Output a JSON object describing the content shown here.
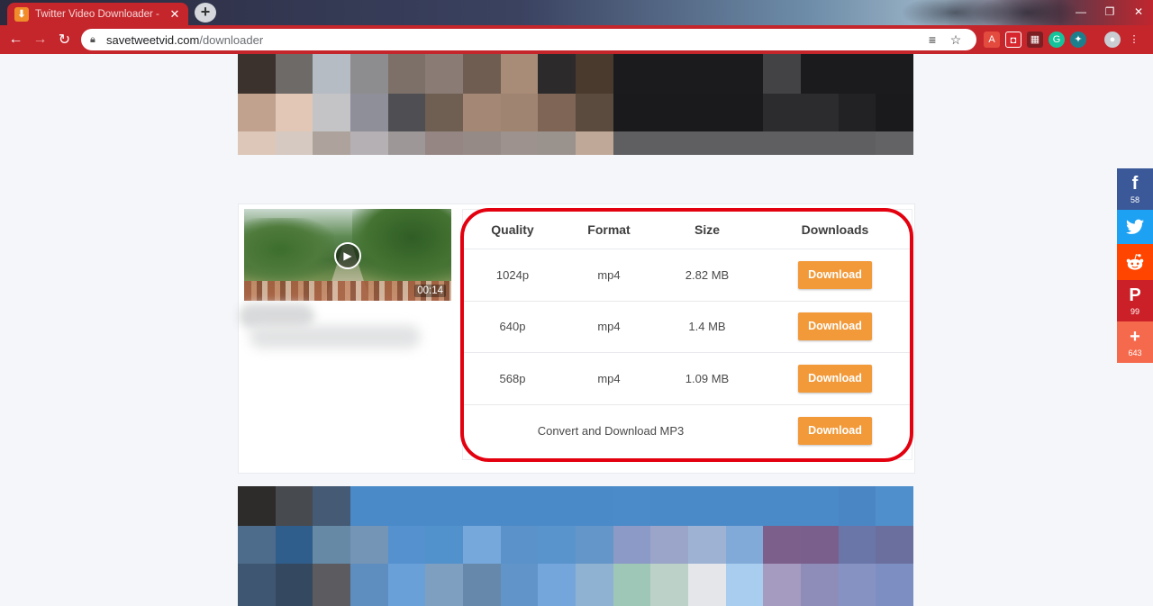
{
  "browser": {
    "tab_title": "Twitter Video Downloader - Dow",
    "url_host": "savetweetvid.com",
    "url_path": "/downloader"
  },
  "video": {
    "duration": "00:14"
  },
  "table": {
    "headers": [
      "Quality",
      "Format",
      "Size",
      "Downloads"
    ],
    "rows": [
      {
        "quality": "1024p",
        "format": "mp4",
        "size": "2.82 MB",
        "button": "Download"
      },
      {
        "quality": "640p",
        "format": "mp4",
        "size": "1.4 MB",
        "button": "Download"
      },
      {
        "quality": "568p",
        "format": "mp4",
        "size": "1.09 MB",
        "button": "Download"
      }
    ],
    "mp3": {
      "label": "Convert and Download MP3",
      "button": "Download"
    }
  },
  "share": {
    "facebook_count": "58",
    "pinterest_count": "99",
    "more_count": "643"
  },
  "colors": {
    "browser_red": "#c4262c",
    "download_orange": "#f29a3a",
    "highlight_red": "#e3000f",
    "facebook": "#3b5998",
    "twitter": "#1da1f2",
    "reddit": "#ff4500",
    "pinterest": "#cb2027",
    "more": "#f56a4d"
  }
}
